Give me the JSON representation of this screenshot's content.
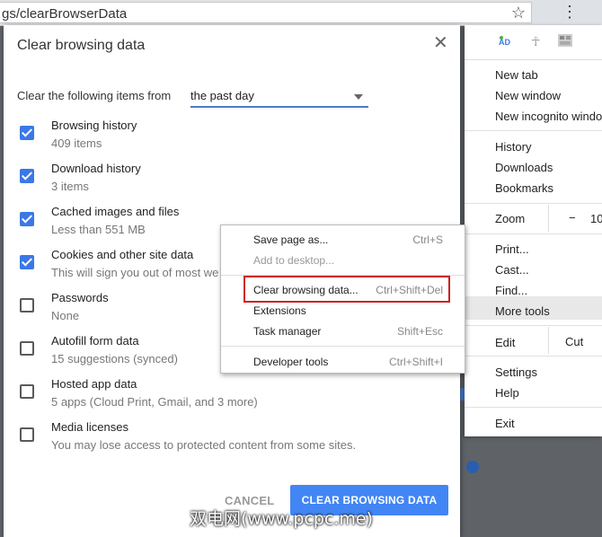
{
  "browser": {
    "url": "gs/clearBrowserData"
  },
  "dialog": {
    "title": "Clear browsing data",
    "range_label": "Clear the following items from",
    "range_value": "the past day",
    "options": [
      {
        "title": "Browsing history",
        "subtitle": "409 items",
        "checked": true
      },
      {
        "title": "Download history",
        "subtitle": "3 items",
        "checked": true
      },
      {
        "title": "Cached images and files",
        "subtitle": "Less than 551 MB",
        "checked": true
      },
      {
        "title": "Cookies and other site data",
        "subtitle": "This will sign you out of most we",
        "checked": true
      },
      {
        "title": "Passwords",
        "subtitle": "None",
        "checked": false
      },
      {
        "title": "Autofill form data",
        "subtitle": "15 suggestions (synced)",
        "checked": false
      },
      {
        "title": "Hosted app data",
        "subtitle": "5 apps (Cloud Print, Gmail, and 3 more)",
        "checked": false
      },
      {
        "title": "Media licenses",
        "subtitle": "You may lose access to protected content from some sites.",
        "checked": false
      }
    ],
    "cancel_label": "CANCEL",
    "clear_label": "CLEAR BROWSING DATA",
    "accent_color": "#4285f4"
  },
  "chrome_menu": {
    "new_tab": "New tab",
    "new_window": "New window",
    "new_incognito": "New incognito window",
    "history": "History",
    "downloads": "Downloads",
    "bookmarks": "Bookmarks",
    "zoom": "Zoom",
    "zoom_minus": "−",
    "zoom_value": "10",
    "print": "Print...",
    "cast": "Cast...",
    "find": "Find...",
    "more_tools": "More tools",
    "edit": "Edit",
    "cut": "Cut",
    "settings": "Settings",
    "help": "Help",
    "exit": "Exit"
  },
  "more_tools_menu": {
    "save_page": "Save page as...",
    "save_page_key": "Ctrl+S",
    "add_desktop": "Add to desktop...",
    "clear_data": "Clear browsing data...",
    "clear_data_key": "Ctrl+Shift+Del",
    "extensions": "Extensions",
    "task_manager": "Task manager",
    "task_manager_key": "Shift+Esc",
    "developer_tools": "Developer tools",
    "developer_tools_key": "Ctrl+Shift+I",
    "highlight_color": "#d01f1f"
  },
  "watermark": "双电网(www.pcpc.me)"
}
